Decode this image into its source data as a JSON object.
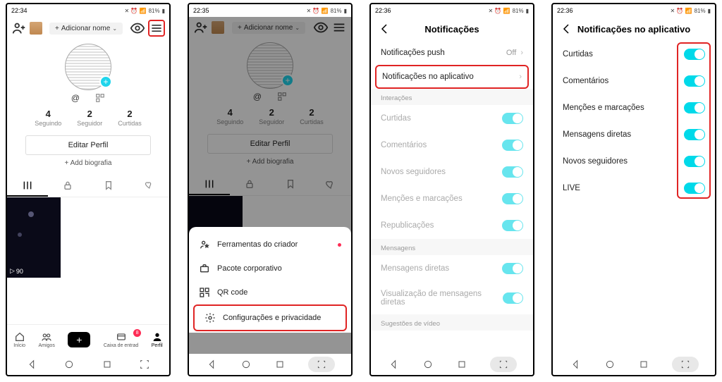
{
  "status": {
    "time1": "22:34",
    "time2": "22:35",
    "time3": "22:36",
    "time4": "22:36",
    "battery": "81%",
    "icons": "⏰ 📶 📶"
  },
  "screen1": {
    "add_name": "Adicionar nome",
    "stats": [
      {
        "n": "4",
        "l": "Seguindo"
      },
      {
        "n": "2",
        "l": "Seguidor"
      },
      {
        "n": "2",
        "l": "Curtidas"
      }
    ],
    "edit": "Editar Perfil",
    "add_bio": "+ Add biografia",
    "plays": "90",
    "bottom": {
      "home": "Início",
      "friends": "Amigos",
      "inbox": "Caixa de entrad",
      "profile": "Perfil",
      "inbox_badge": "8"
    }
  },
  "screen2": {
    "menu": [
      "Ferramentas do criador",
      "Pacote corporativo",
      "QR code",
      "Configurações e privacidade"
    ]
  },
  "screen3": {
    "title": "Notificações",
    "push": "Notificações push",
    "push_val": "Off",
    "in_app": "Notificações no aplicativo",
    "sec_inter": "Interações",
    "items_inter": [
      "Curtidas",
      "Comentários",
      "Novos seguidores",
      "Menções e marcações",
      "Republicações"
    ],
    "sec_msg": "Mensagens",
    "items_msg": [
      "Mensagens diretas",
      "Visualização de mensagens diretas"
    ],
    "sec_vid": "Sugestões de vídeo"
  },
  "screen4": {
    "title": "Notificações no aplicativo",
    "items": [
      "Curtidas",
      "Comentários",
      "Menções e marcações",
      "Mensagens diretas",
      "Novos seguidores",
      "LIVE"
    ]
  }
}
